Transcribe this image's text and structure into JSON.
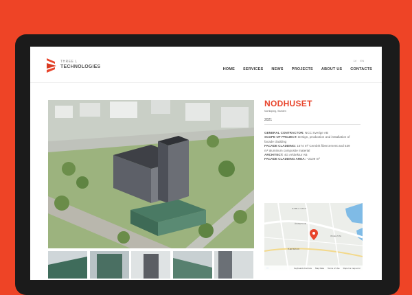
{
  "brand": {
    "line1": "THREE L",
    "line2": "TECHNOLOGIES",
    "color": "#e8452c"
  },
  "languages": [
    "LV",
    "EN"
  ],
  "nav": [
    "HOME",
    "SERVICES",
    "NEWS",
    "PROJECTS",
    "ABOUT US",
    "CONTACTS"
  ],
  "project": {
    "title": "NODHUSET",
    "location": "Norrköping, Sweden",
    "year": "2021",
    "details": [
      {
        "label": "GENERAL CONTRACTOR:",
        "value": "NCC Sverige AB"
      },
      {
        "label": "SCOPE OF PROJECT:",
        "value": "Design, production and installation of facade cladding"
      },
      {
        "label": "FACADE CLADDING:",
        "value": "1574 m² Cembrit fibercement and 539 m² aluminum composite material"
      },
      {
        "label": "ARCHITECT:",
        "value": "4G Arkitektur AB"
      },
      {
        "label": "FACADE CLADDING AREA:",
        "value": "~2109 m²"
      }
    ]
  },
  "map": {
    "places": [
      "GAMLA STAN",
      "ÖNSETIND",
      "INGELSTA",
      "Karlshov"
    ],
    "footer": [
      "Keyboard shortcuts",
      "Map Data",
      "Terms of Use",
      "Report a map error"
    ],
    "pin_color": "#e8452c"
  },
  "thumbnails": [
    "thumb-1",
    "thumb-2",
    "thumb-3",
    "thumb-4",
    "thumb-5"
  ]
}
